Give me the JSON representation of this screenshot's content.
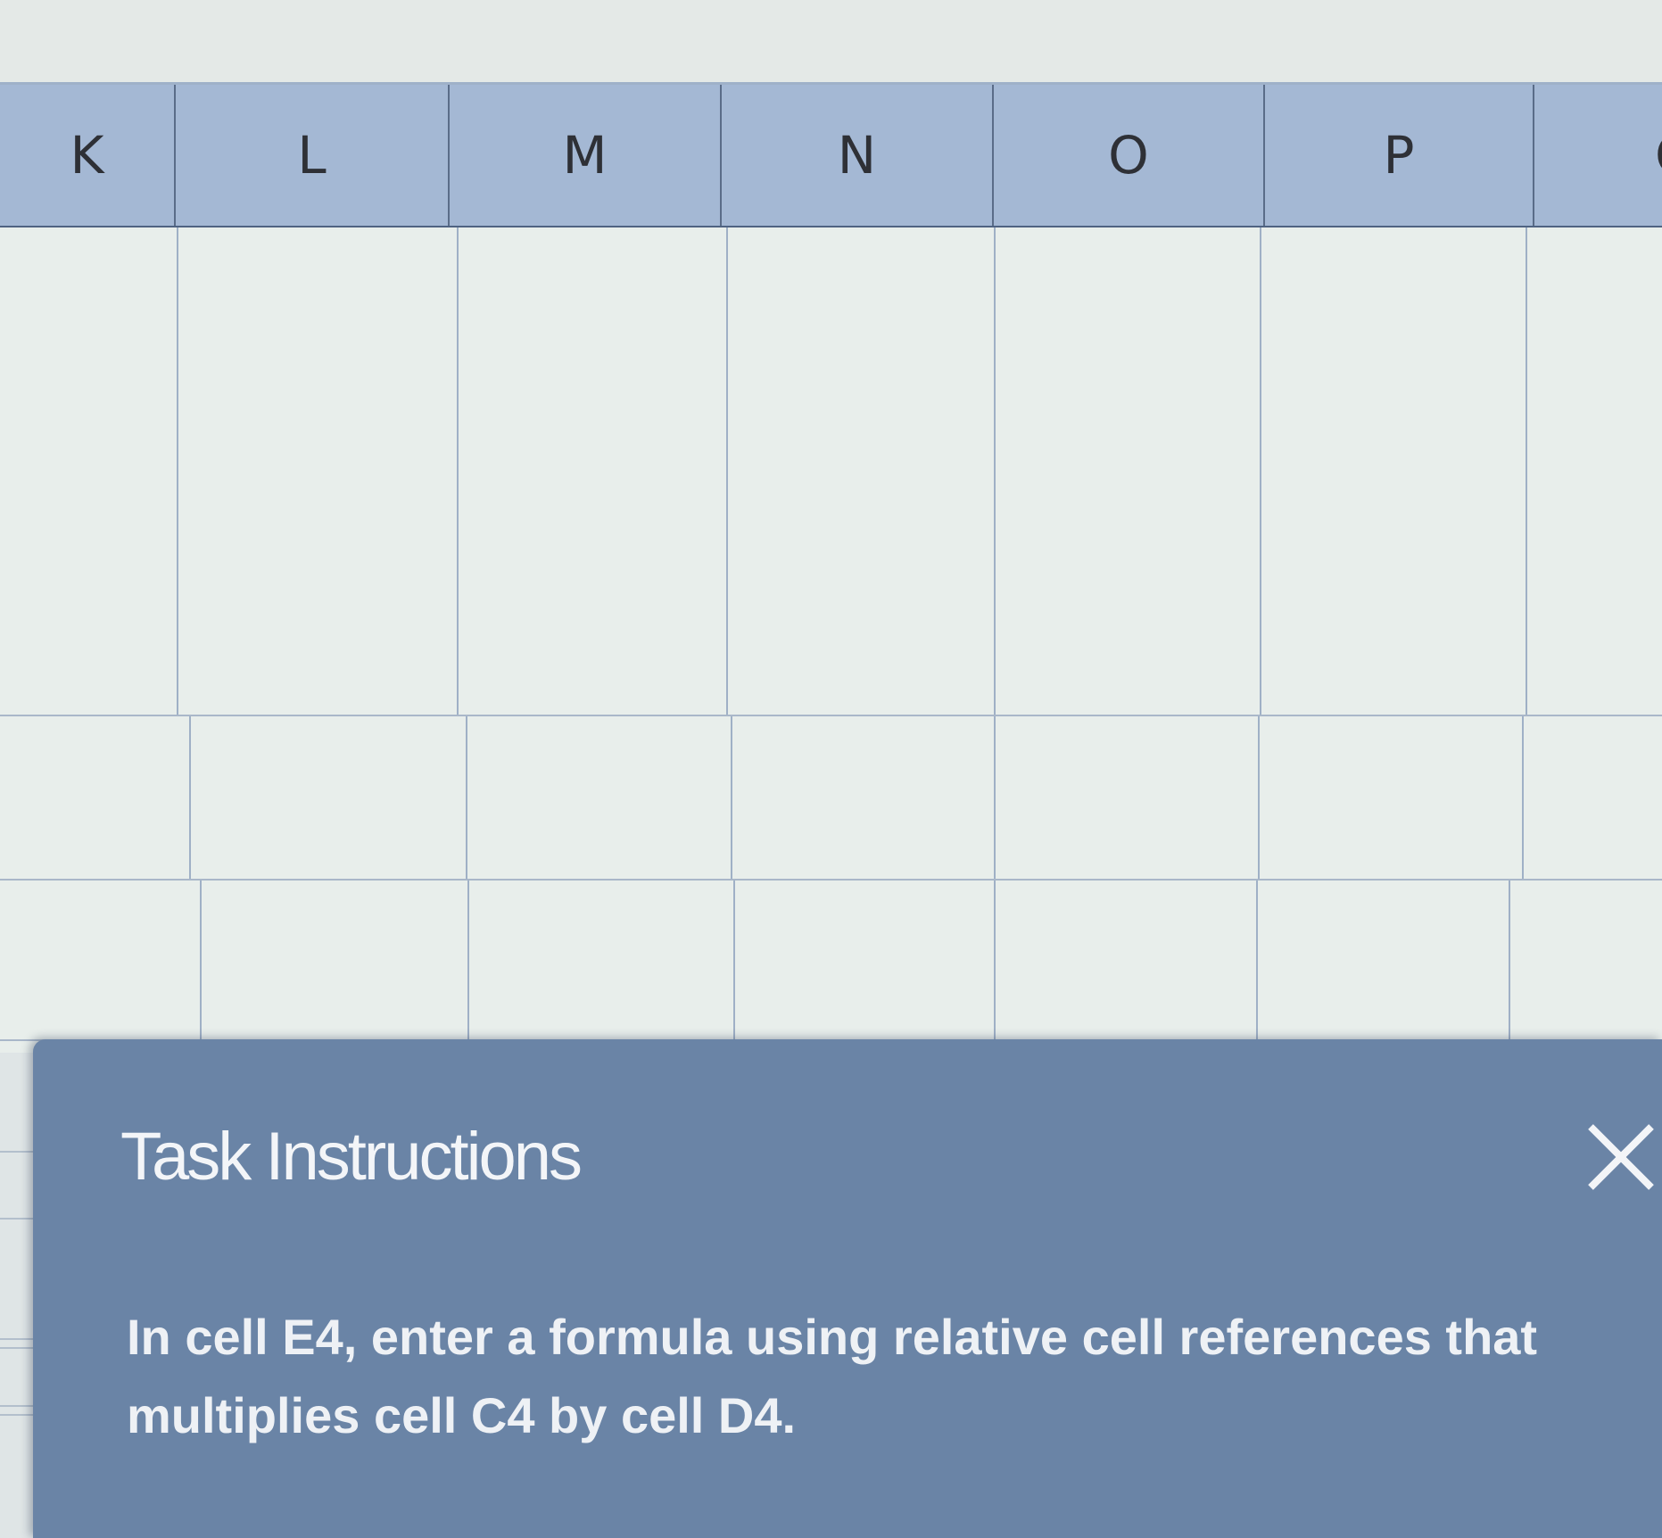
{
  "spreadsheet": {
    "columns": [
      "K",
      "L",
      "M",
      "N",
      "O",
      "P",
      "Q"
    ],
    "row_count_visible": 4
  },
  "task_panel": {
    "title": "Task Instructions",
    "instruction": "In cell E4, enter a formula using relative cell references that multiplies cell C4 by cell D4.",
    "close_icon": "close-icon",
    "background_color": "#6a84a6"
  }
}
